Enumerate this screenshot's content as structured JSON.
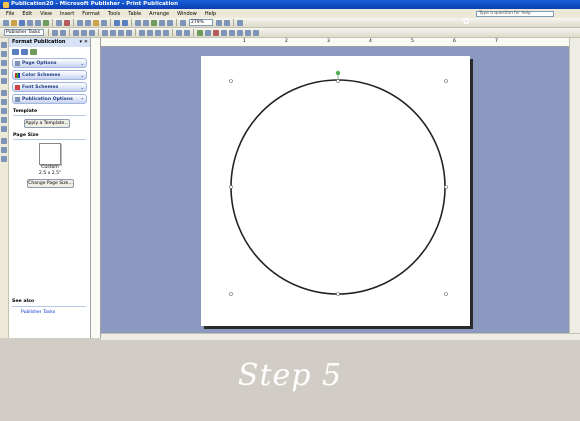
{
  "window": {
    "title": "Publication20 - Microsoft Publisher - Print Publication"
  },
  "menu": {
    "items": [
      "File",
      "Edit",
      "View",
      "Insert",
      "Format",
      "Tools",
      "Table",
      "Arrange",
      "Window",
      "Help"
    ],
    "question_placeholder": "Type a question for help"
  },
  "toolbar": {
    "zoom": "279%",
    "task_box": "Publisher Tasks"
  },
  "task_pane": {
    "title": "Format Publication",
    "sections": [
      {
        "label": "Page Options",
        "icon": "page-options-icon"
      },
      {
        "label": "Color Schemes",
        "icon": "color-schemes-icon"
      },
      {
        "label": "Font Schemes",
        "icon": "font-schemes-icon"
      },
      {
        "label": "Publication Options",
        "icon": "publication-options-icon"
      }
    ],
    "template_label": "Template",
    "apply_template_button": "Apply a Template...",
    "page_size_label": "Page Size",
    "size_name": "Custom",
    "size_dims": "2.5 x 2.5\"",
    "change_size_button": "Change Page Size...",
    "see_also_label": "See also",
    "see_also_link": "Publisher Tasks"
  },
  "ruler": {
    "numbers": [
      "1",
      "2",
      "3",
      "4",
      "5",
      "6",
      "7"
    ]
  },
  "caption": {
    "text": "Step 5"
  },
  "colors": {
    "workspace": "#8b99c1",
    "caption_background": "#d1cdc6",
    "title_bar": "#1a5fd8",
    "rotate_handle": "#4caf50"
  }
}
